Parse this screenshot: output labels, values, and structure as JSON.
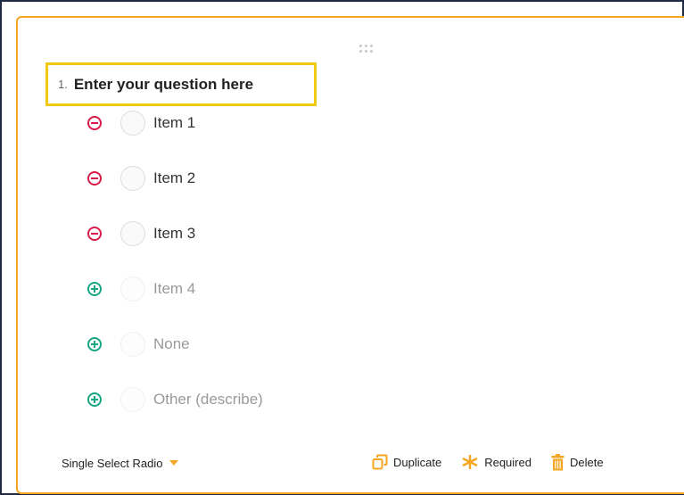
{
  "question": {
    "number": "1.",
    "text": "Enter your question here"
  },
  "options": [
    {
      "label": "Item 1",
      "action": "remove",
      "action_icon": "minus-circle-icon"
    },
    {
      "label": "Item 2",
      "action": "remove",
      "action_icon": "minus-circle-icon"
    },
    {
      "label": "Item 3",
      "action": "remove",
      "action_icon": "minus-circle-icon"
    },
    {
      "label": "Item 4",
      "action": "add",
      "action_icon": "plus-circle-icon"
    },
    {
      "label": "None",
      "action": "add",
      "action_icon": "plus-circle-icon"
    },
    {
      "label": "Other (describe)",
      "action": "add",
      "action_icon": "plus-circle-icon"
    }
  ],
  "footer": {
    "question_type": "Single Select Radio",
    "duplicate_label": "Duplicate",
    "required_label": "Required",
    "delete_label": "Delete"
  },
  "colors": {
    "accent": "#f5a623",
    "title_highlight": "#f2c811",
    "remove": "#d81b47",
    "add": "#17a683"
  }
}
